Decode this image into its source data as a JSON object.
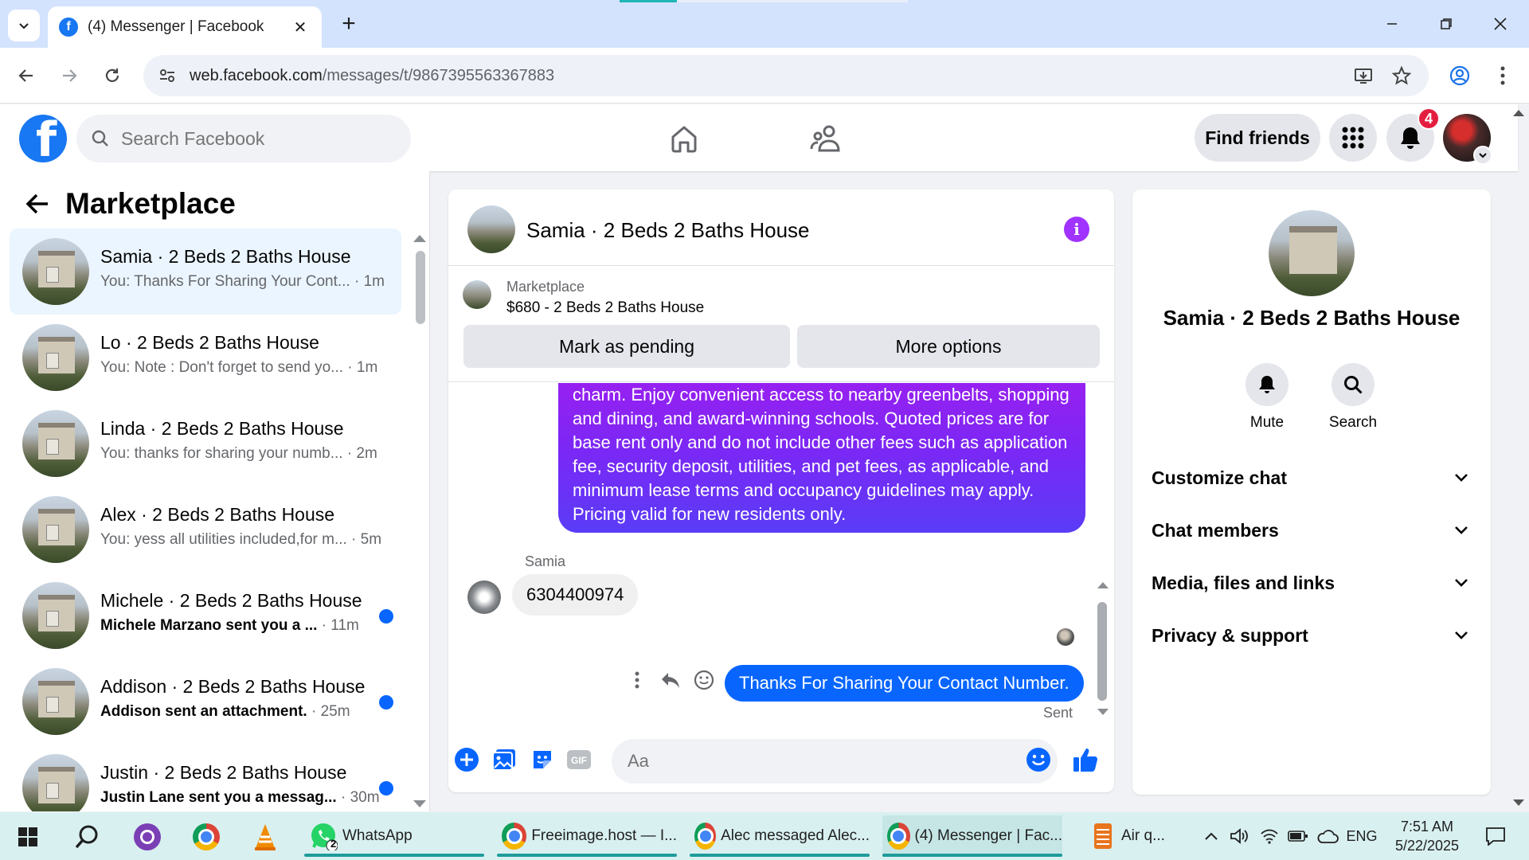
{
  "browser": {
    "tab_title": "(4) Messenger | Facebook",
    "url_host": "web.facebook.com",
    "url_path": "/messages/t/9867395563367883"
  },
  "fb_header": {
    "search_placeholder": "Search Facebook",
    "find_friends_label": "Find friends",
    "notification_count": "4"
  },
  "sidebar": {
    "title": "Marketplace",
    "chats": [
      {
        "name": "Samia · 2 Beds 2 Baths House",
        "preview": "You: Thanks For Sharing Your Cont...",
        "time": " · 1m",
        "unread": false,
        "active": true
      },
      {
        "name": "Lo · 2 Beds 2 Baths House",
        "preview": "You: Note : Don't forget to send yo...",
        "time": " · 1m",
        "unread": false,
        "active": false
      },
      {
        "name": "Linda · 2 Beds 2 Baths House",
        "preview": "You: thanks for sharing your numb...",
        "time": " · 2m",
        "unread": false,
        "active": false
      },
      {
        "name": "Alex · 2 Beds 2 Baths House",
        "preview": "You: yess all utilities included,for m...",
        "time": " · 5m",
        "unread": false,
        "active": false
      },
      {
        "name": "Michele · 2 Beds 2 Baths House",
        "preview": "Michele Marzano sent you a ...",
        "time": " · 11m",
        "unread": true,
        "active": false
      },
      {
        "name": "Addison · 2 Beds 2 Baths House",
        "preview": "Addison sent an attachment.",
        "time": " · 25m",
        "unread": true,
        "active": false
      },
      {
        "name": "Justin · 2 Beds 2 Baths House",
        "preview": "Justin Lane sent you a messag...",
        "time": " · 30m",
        "unread": true,
        "active": false
      }
    ]
  },
  "conversation": {
    "title": "Samia · 2 Beds 2 Baths House",
    "listing_label": "Marketplace",
    "listing_desc": "$680 - 2 Beds 2 Baths House",
    "mark_pending_label": "Mark as pending",
    "more_options_label": "More options",
    "long_message": "charm. Enjoy convenient access to nearby greenbelts, shopping and dining, and award-winning schools. Quoted prices are for base rent only and do not include other fees such as application fee, security deposit, utilities, and pet fees, as applicable, and minimum lease terms and occupancy guidelines may apply. Pricing valid for new residents only.",
    "sender_name": "Samia",
    "incoming_message": "6304400974",
    "outgoing_message": "Thanks For Sharing Your Contact Number.",
    "status": "Sent",
    "composer_placeholder": "Aa"
  },
  "info_panel": {
    "name": "Samia · 2 Beds 2 Baths House",
    "mute_label": "Mute",
    "search_label": "Search",
    "sections": [
      "Customize chat",
      "Chat members",
      "Media, files and links",
      "Privacy & support"
    ]
  },
  "taskbar": {
    "apps": [
      "WhatsApp",
      "Freeimage.host — I...",
      "Alec messaged Alec...",
      "(4) Messenger | Fac...",
      "Air q..."
    ],
    "whatsapp_badge": "2",
    "language": "ENG",
    "time": "7:51 AM",
    "date": "5/22/2025"
  },
  "colors": {
    "facebook_blue": "#1877f2",
    "messenger_blue": "#0866ff",
    "gradient_purple": "#9b1ff0",
    "unread_dot": "#0866ff",
    "badge_red": "#e41e3f"
  }
}
